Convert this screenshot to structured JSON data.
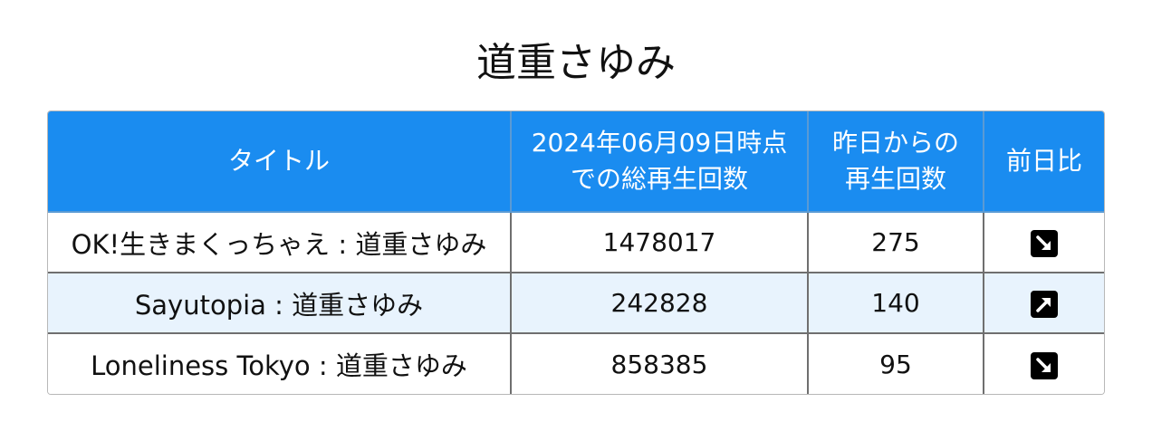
{
  "page_title": "道重さゆみ",
  "table": {
    "headers": {
      "title": "タイトル",
      "total_line1": "2024年06月09日時点",
      "total_line2": "での総再生回数",
      "day_line1": "昨日からの",
      "day_line2": "再生回数",
      "compare": "前日比"
    },
    "rows": [
      {
        "title": "OK!生きまくっちゃえ : 道重さゆみ",
        "total": "1478017",
        "day": "275",
        "trend_icon": "arrow-down-right-icon"
      },
      {
        "title": "Sayutopia : 道重さゆみ",
        "total": "242828",
        "day": "140",
        "trend_icon": "arrow-up-right-icon"
      },
      {
        "title": "Loneliness Tokyo : 道重さゆみ",
        "total": "858385",
        "day": "95",
        "trend_icon": "arrow-down-right-icon"
      }
    ]
  },
  "colors": {
    "header_bg": "#1a8cf0",
    "alt_row_bg": "#e8f3fd",
    "icon_bg": "#000000"
  }
}
